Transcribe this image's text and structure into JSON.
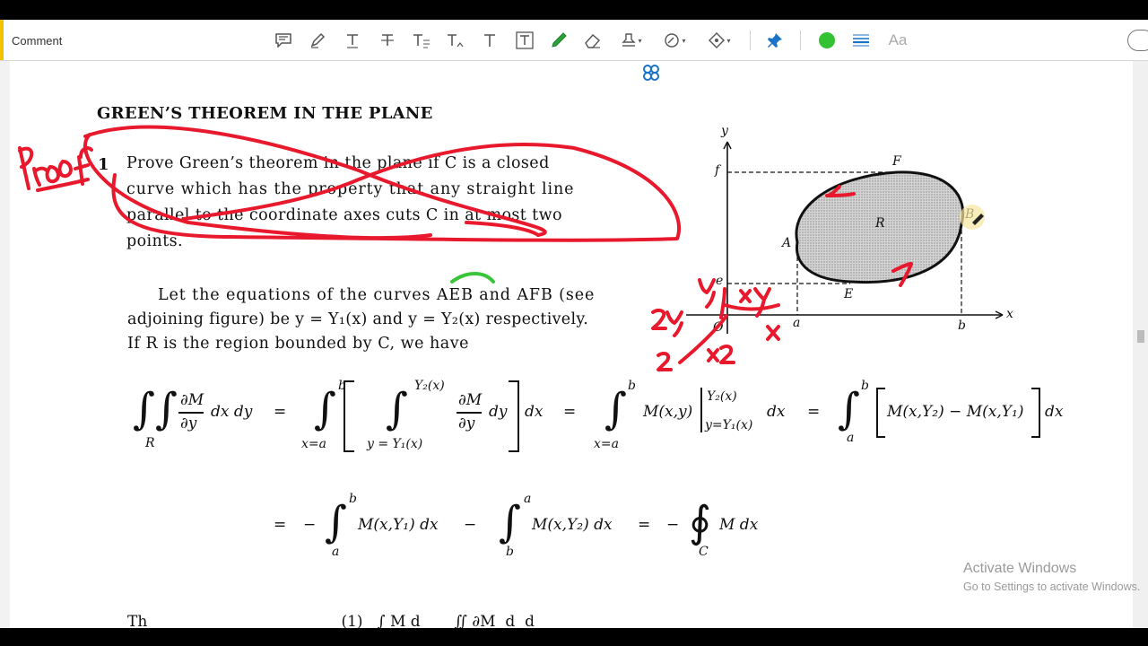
{
  "toolbar": {
    "title": "Comment",
    "tools": [
      {
        "name": "sticky-note-icon",
        "glyph": "▭"
      },
      {
        "name": "highlight-icon",
        "glyph": "✎"
      },
      {
        "name": "underline-text-icon",
        "glyph": "T"
      },
      {
        "name": "strikethrough-text-icon",
        "glyph": "T"
      },
      {
        "name": "replace-text-icon",
        "glyph": "T"
      },
      {
        "name": "insert-text-icon",
        "glyph": "T"
      },
      {
        "name": "add-text-comment-icon",
        "glyph": "T"
      },
      {
        "name": "text-box-icon",
        "glyph": "T"
      },
      {
        "name": "pencil-icon",
        "glyph": "✎"
      },
      {
        "name": "eraser-icon",
        "glyph": "◇"
      },
      {
        "name": "stamp-icon",
        "glyph": "♜"
      },
      {
        "name": "attach-file-icon",
        "glyph": "⊘"
      },
      {
        "name": "shapes-icon",
        "glyph": "☆"
      },
      {
        "name": "pin-icon",
        "glyph": "📌"
      },
      {
        "name": "color-picker-icon",
        "glyph": "●"
      },
      {
        "name": "line-width-icon",
        "glyph": "≡"
      },
      {
        "name": "text-properties-icon",
        "glyph": "Aa"
      }
    ],
    "accent_color": "#f0c200",
    "drawing_color": "#33c233"
  },
  "document": {
    "heading": "GREEN’S THEOREM IN THE PLANE",
    "problem_number": "1",
    "problem_lines": [
      "Prove Green’s theorem in the plane if C is a closed",
      "curve which has the property that any straight line",
      "parallel to the coordinate axes cuts C in at most two",
      "points."
    ],
    "body_lines": [
      "Let the equations of the curves AEB and AFB (see",
      "adjoining figure) be y = Y₁(x) and y = Y₂(x) respectively.",
      "If R is the region bounded by C, we have"
    ],
    "figure_labels": {
      "y_axis": "y",
      "x_axis": "x",
      "f": "f",
      "e": "e",
      "a": "a",
      "b": "b",
      "F": "F",
      "A": "A",
      "E": "E",
      "B": "B",
      "R": "R",
      "O": "O"
    },
    "eq1": {
      "lhs_region": "R",
      "lhs_frac_num": "∂M",
      "lhs_frac_den": "∂y",
      "lhs_diff": "dx dy",
      "eq": "=",
      "lim_low_xa": "x=a",
      "lim_b": "b",
      "inner_upper": "Y₂(x)",
      "inner_lower": "y = Y₁(x)",
      "inner_frac_num": "∂M",
      "inner_frac_den": "∂y",
      "inner_diff": "dy",
      "outer_diff": "dx",
      "mid_term": "M(x,y)",
      "mid_upper": "Y₂(x)",
      "mid_lower": "y=Y₁(x)",
      "mid_diff": "dx",
      "right_lower": "a",
      "right_term": "M(x,Y₂) − M(x,Y₁)",
      "right_diff": "dx"
    },
    "eq2": {
      "eq": "=",
      "minus": "−",
      "first_upper": "b",
      "first_lower": "a",
      "first_term": "M(x,Y₁) dx",
      "second_upper": "a",
      "second_lower": "b",
      "second_term": "M(x,Y₂) dx",
      "contour_lower": "C",
      "contour_term": "M dx"
    },
    "partial_bottom_line": "Th                                        (1)   ∫ M d       ∬ ∂M  d  d"
  },
  "annotations": {
    "proof_label": "Proof",
    "ink_color": "#e8192c",
    "green_ink_color": "#39c53a",
    "handwriting": [
      "y",
      "xy",
      "zy",
      "x",
      "z",
      "xz"
    ]
  },
  "watermark": {
    "title": "Activate Windows",
    "subtitle": "Go to Settings to activate Windows."
  }
}
